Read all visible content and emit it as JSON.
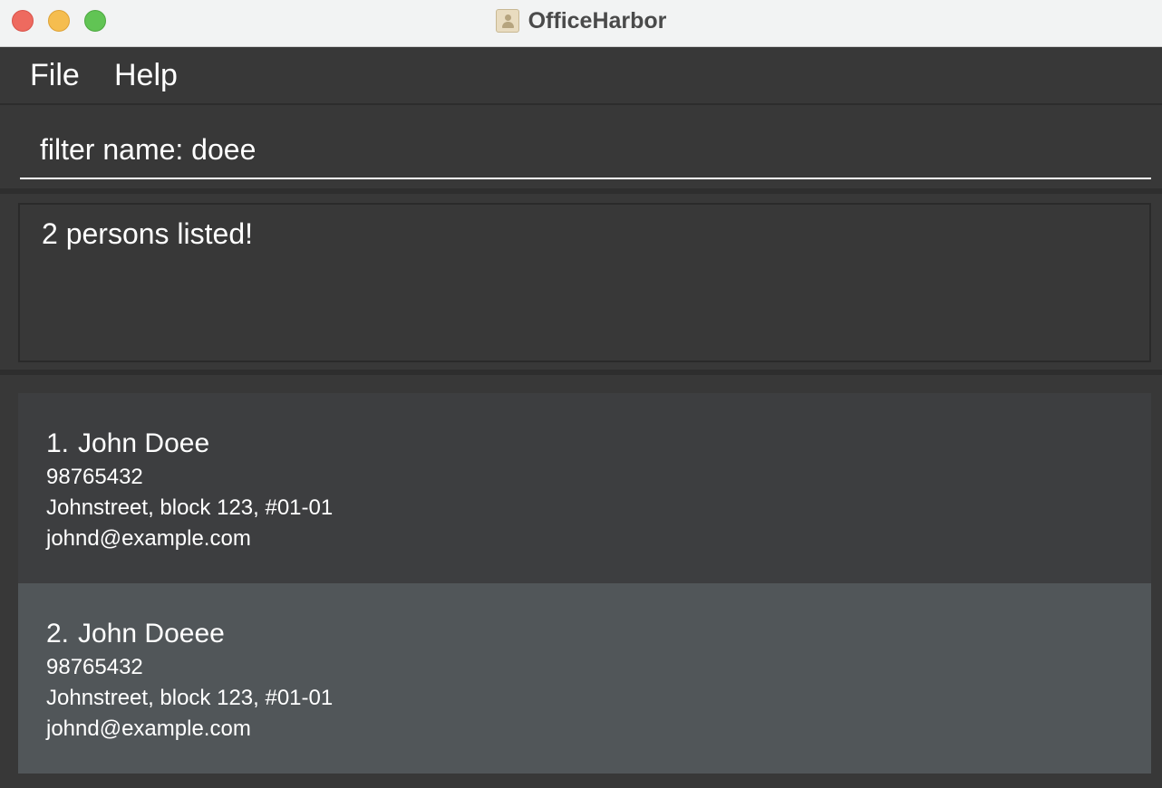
{
  "window": {
    "title": "OfficeHarbor"
  },
  "menu": {
    "file_label": "File",
    "help_label": "Help"
  },
  "command": {
    "value": "filter name: doee"
  },
  "result": {
    "message": "2 persons listed!"
  },
  "persons": [
    {
      "index": "1.",
      "name": "John Doee",
      "phone": "98765432",
      "address": "Johnstreet, block 123, #01-01",
      "email": "johnd@example.com"
    },
    {
      "index": "2.",
      "name": "John Doeee",
      "phone": "98765432",
      "address": "Johnstreet, block 123, #01-01",
      "email": "johnd@example.com"
    }
  ],
  "colors": {
    "background": "#383838",
    "card_odd": "#3d3e40",
    "card_even": "#515659",
    "text": "#ffffff"
  },
  "icons": {
    "app_icon": "address-book-icon",
    "close": "close-traffic-light",
    "minimize": "minimize-traffic-light",
    "maximize": "maximize-traffic-light"
  }
}
